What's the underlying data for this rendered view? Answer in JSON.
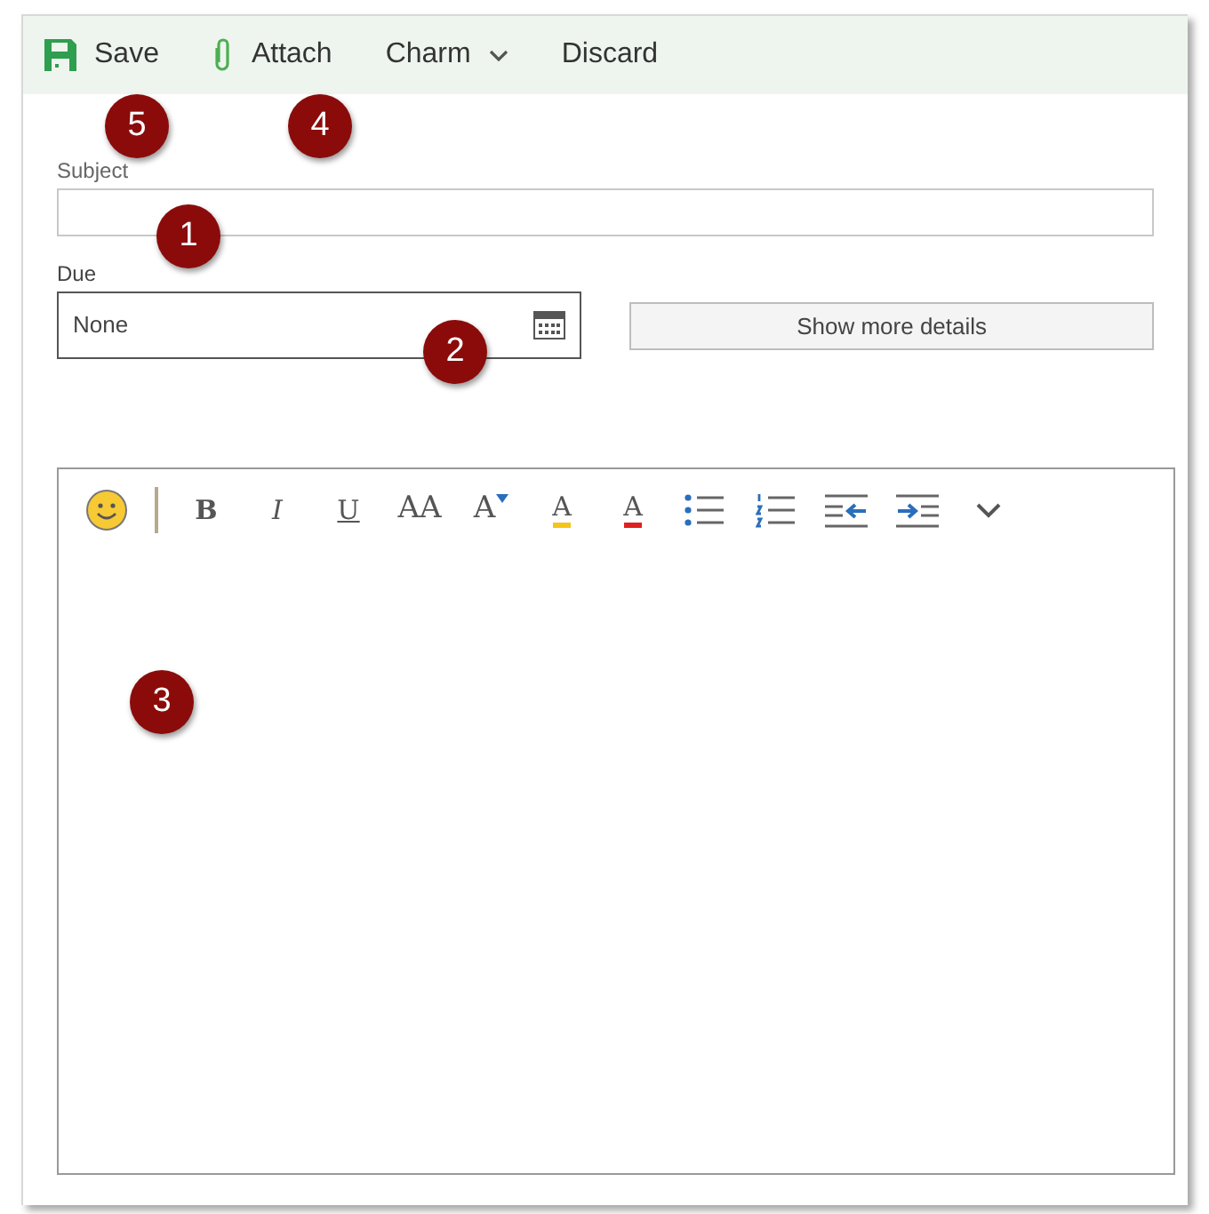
{
  "command_bar": [
    {
      "kind": "save",
      "label": "Save"
    },
    {
      "kind": "attach",
      "label": "Attach"
    },
    {
      "kind": "menu",
      "label": "Charm"
    },
    {
      "kind": "plain",
      "label": "Discard"
    }
  ],
  "subject": {
    "label": "Subject"
  },
  "due": {
    "label": "Due",
    "value": "None"
  },
  "details_button": {
    "label": "Show more details"
  },
  "editor_toolbar": [
    {
      "kind": "emoji"
    },
    {
      "kind": "separator"
    },
    {
      "kind": "bold",
      "glyph": "B"
    },
    {
      "kind": "italic",
      "glyph": "I"
    },
    {
      "kind": "underline",
      "glyph": "U"
    },
    {
      "kind": "font-size",
      "glyph": "AA"
    },
    {
      "kind": "grow",
      "glyph": "A"
    },
    {
      "kind": "highlight",
      "glyph": "A"
    },
    {
      "kind": "font-color",
      "glyph": "A"
    },
    {
      "kind": "bullets"
    },
    {
      "kind": "numbering"
    },
    {
      "kind": "outdent"
    },
    {
      "kind": "indent"
    },
    {
      "kind": "more"
    }
  ],
  "callouts": [
    "5",
    "4",
    "1",
    "2",
    "3"
  ]
}
